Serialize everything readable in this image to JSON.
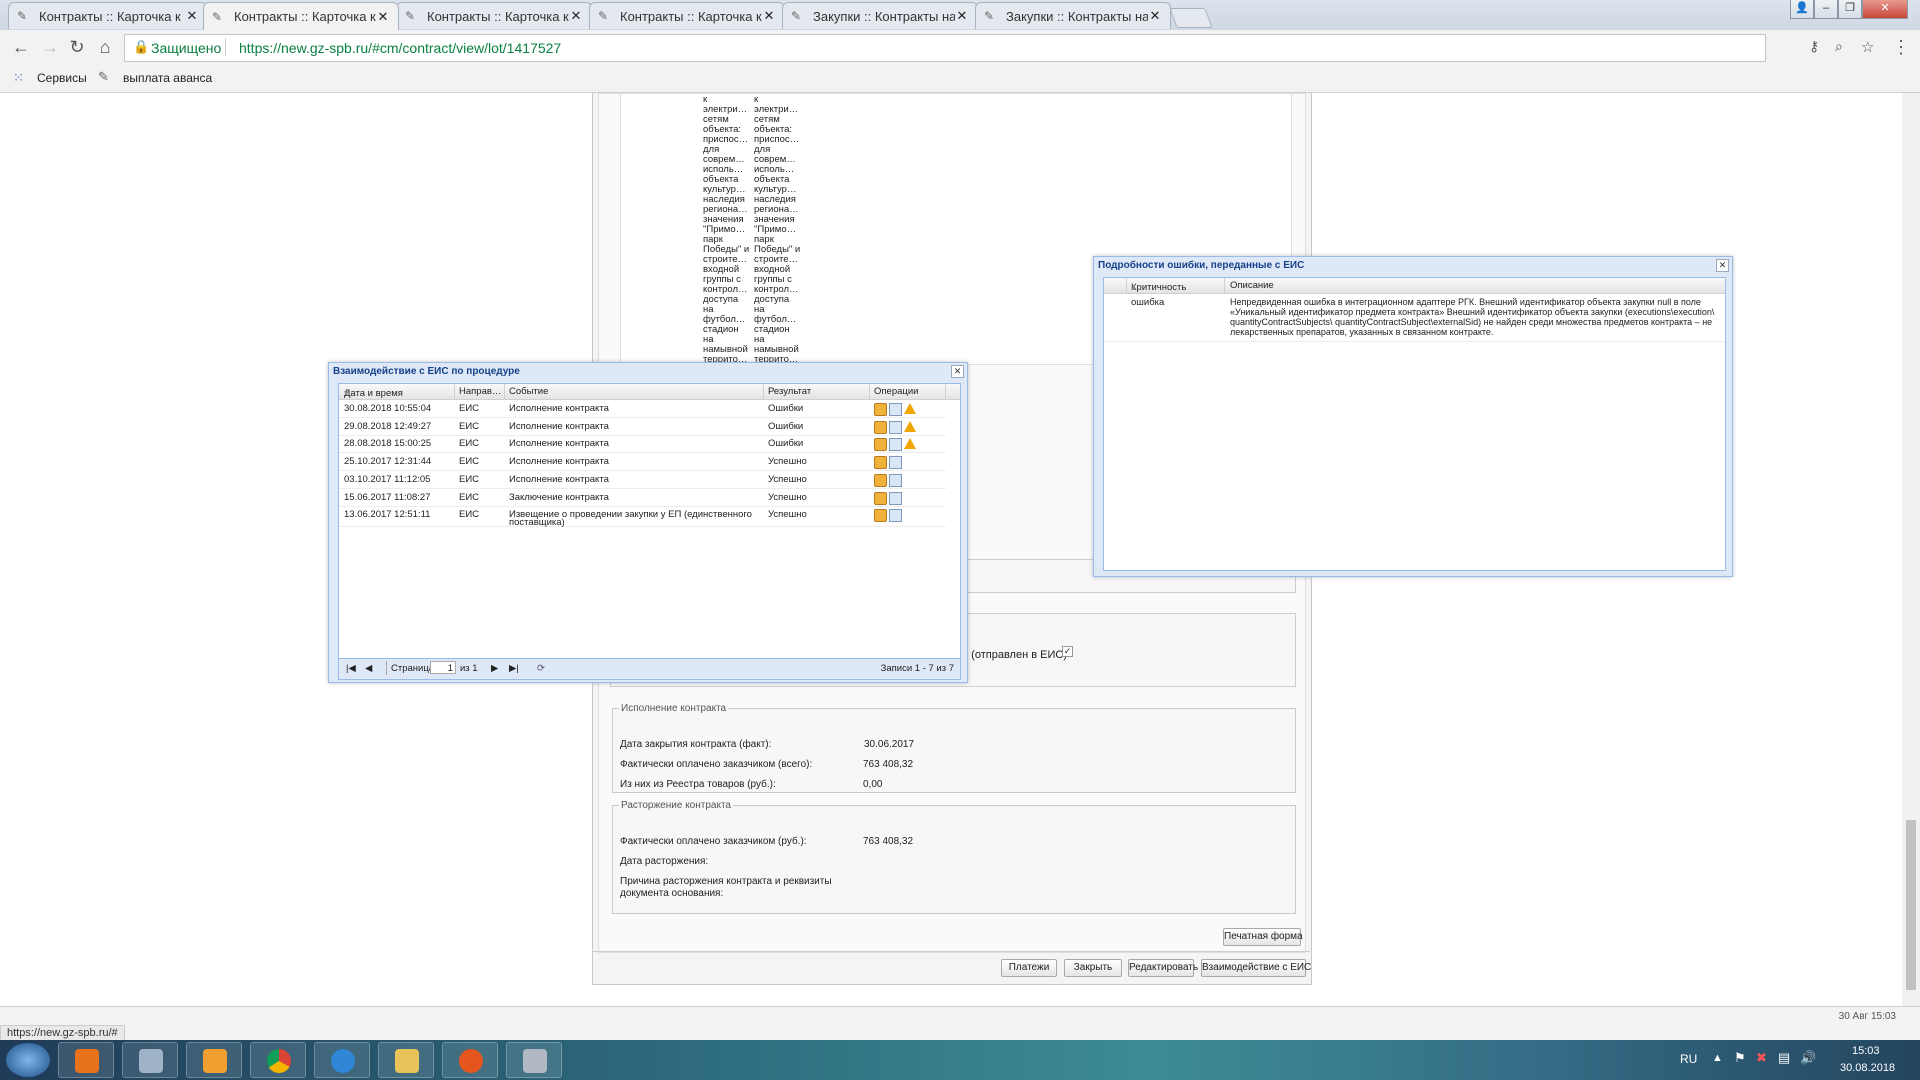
{
  "browser": {
    "tabs": [
      {
        "title": "Контракты :: Карточка к"
      },
      {
        "title": "Контракты :: Карточка к"
      },
      {
        "title": "Контракты :: Карточка к"
      },
      {
        "title": "Контракты :: Карточка к"
      },
      {
        "title": "Закупки :: Контракты на"
      },
      {
        "title": "Закупки :: Контракты на"
      }
    ],
    "secure_label": "Защищено",
    "url": "https://new.gz-spb.ru/#cm/contract/view/lot/1417527",
    "bookmarks": [
      "Сервисы",
      "выплата аванса"
    ],
    "status_url": "https://new.gz-spb.ru/#"
  },
  "page": {
    "subject_fragment_lines": [
      "к",
      "электри…",
      "сетям",
      "объекта:",
      "приспос…",
      "для",
      "соврем…",
      "исполь…",
      "объекта",
      "культур…",
      "наследия",
      "региона…",
      "значения",
      "\"Примо…",
      "парк",
      "Победы\" и",
      "строите…",
      "входной",
      "группы с",
      "контрол…",
      "доступа",
      "на",
      "футбол…",
      "стадион",
      "на",
      "намывной",
      "террито…"
    ],
    "sent_to_eis_text": "5 (отправлен в ЕИС)",
    "execution": {
      "legend": "Исполнение контракта",
      "rows": [
        {
          "label": "Дата закрытия контракта (факт):",
          "value": "30.06.2017"
        },
        {
          "label": "Фактически оплачено заказчиком (всего):",
          "value": "763 408,32"
        },
        {
          "label": "Из них из Реестра товаров (руб.):",
          "value": "0,00"
        }
      ]
    },
    "termination": {
      "legend": "Расторжение контракта",
      "paid_label": "Фактически оплачено заказчиком (руб.):",
      "paid_value": "763 408,32",
      "date_label": "Дата расторжения:",
      "reason_label_1": "Причина расторжения контракта и реквизиты",
      "reason_label_2": "документа основания:"
    },
    "print_button": "Печатная форма",
    "buttons": [
      "Платежи",
      "Закрыть",
      "Редактировать",
      "Взаимодействие с ЕИС"
    ],
    "footer_left": "©",
    "footer_right": "30 Авг 15:03"
  },
  "eis_window": {
    "title": "Взаимодействие с ЕИС по процедуре",
    "columns": [
      "Дата и время",
      "Направ…",
      "Событие",
      "Результат",
      "Операции"
    ],
    "sort_indicator": "▾",
    "rows": [
      {
        "date": "30.08.2018 10:55:04",
        "dir": "ЕИС",
        "event": "Исполнение контракта",
        "result": "Ошибки",
        "warn": true
      },
      {
        "date": "29.08.2018 12:49:27",
        "dir": "ЕИС",
        "event": "Исполнение контракта",
        "result": "Ошибки",
        "warn": true
      },
      {
        "date": "28.08.2018 15:00:25",
        "dir": "ЕИС",
        "event": "Исполнение контракта",
        "result": "Ошибки",
        "warn": true
      },
      {
        "date": "25.10.2017 12:31:44",
        "dir": "ЕИС",
        "event": "Исполнение контракта",
        "result": "Успешно",
        "warn": false
      },
      {
        "date": "03.10.2017 11:12:05",
        "dir": "ЕИС",
        "event": "Исполнение контракта",
        "result": "Успешно",
        "warn": false
      },
      {
        "date": "15.06.2017 11:08:27",
        "dir": "ЕИС",
        "event": "Заключение контракта",
        "result": "Успешно",
        "warn": false
      },
      {
        "date": "13.06.2017 12:51:11",
        "dir": "ЕИС",
        "event": "Извещение о проведении закупки у ЕП (единственного",
        "event2": "поставщика)",
        "result": "Успешно",
        "warn": false
      }
    ],
    "page_label": "Страница",
    "page_value": "1",
    "of_label": "из 1",
    "records": "Записи 1 - 7 из 7"
  },
  "error_window": {
    "title": "Подробности ошибки, переданные с ЕИС",
    "columns": [
      "Критичность",
      "Описание"
    ],
    "sort_indicator": "▴",
    "rows": [
      {
        "severity": "ошибка",
        "description_lines": [
          "Непредвиденная ошибка в интеграционном адаптере РГК. Внешний идентификатор объекта закупки null в поле",
          "«Уникальный идентификатор предмета контракта» Внешний идентификатор объекта закупки (executions\\execution\\",
          "quantityContractSubjects\\ quantityContractSubject\\externalSid) не найден среди множества предметов контракта – не",
          "лекарственных препаратов, указанных в связанном контракте."
        ]
      }
    ]
  },
  "taskbar": {
    "lang": "RU",
    "time": "15:03",
    "date": "30.08.2018"
  }
}
